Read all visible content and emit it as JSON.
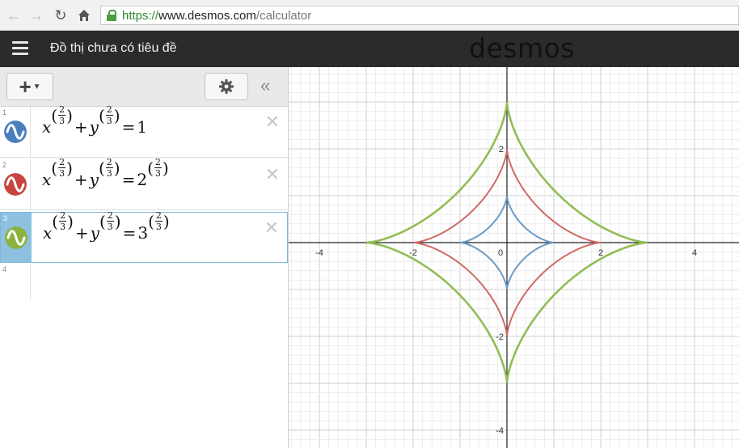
{
  "browser": {
    "url_scheme": "https://",
    "url_host": "www.desmos.com",
    "url_path": "/calculator"
  },
  "header": {
    "title": "Đồ thị chưa có tiêu đề",
    "brand": "desmos"
  },
  "expressions": [
    {
      "index": "1",
      "color": "#4a7fbf",
      "rhs_num": "1",
      "rhs_has_exp": false,
      "lhs": {
        "x": "x",
        "y": "y",
        "exp_num": "2",
        "exp_den": "3",
        "plus": "+",
        "eq": "="
      }
    },
    {
      "index": "2",
      "color": "#c74440",
      "rhs_num": "2",
      "rhs_has_exp": true,
      "lhs": {
        "x": "x",
        "y": "y",
        "exp_num": "2",
        "exp_den": "3",
        "plus": "+",
        "eq": "="
      }
    },
    {
      "index": "3",
      "color": "#8bb33f",
      "rhs_num": "3",
      "rhs_has_exp": true,
      "lhs": {
        "x": "x",
        "y": "y",
        "exp_num": "2",
        "exp_den": "3",
        "plus": "+",
        "eq": "="
      }
    }
  ],
  "empty_row_index": "4",
  "chart_data": {
    "type": "line",
    "x_ticks": [
      "-4",
      "-2",
      "0",
      "2",
      "4"
    ],
    "y_ticks": [
      "2",
      "-2",
      "-4"
    ],
    "xlim": [
      -4.2,
      5.0
    ],
    "ylim": [
      -4.3,
      2.8
    ],
    "grid": true,
    "series": [
      {
        "equation": "x^(2/3)+y^(2/3)=1",
        "radius": 1,
        "color": "#6d9ac6"
      },
      {
        "equation": "x^(2/3)+y^(2/3)=2^(2/3)",
        "radius": 2,
        "color": "#cf6b67"
      },
      {
        "equation": "x^(2/3)+y^(2/3)=3^(2/3)",
        "radius": 3,
        "color": "#92bd55"
      }
    ]
  }
}
